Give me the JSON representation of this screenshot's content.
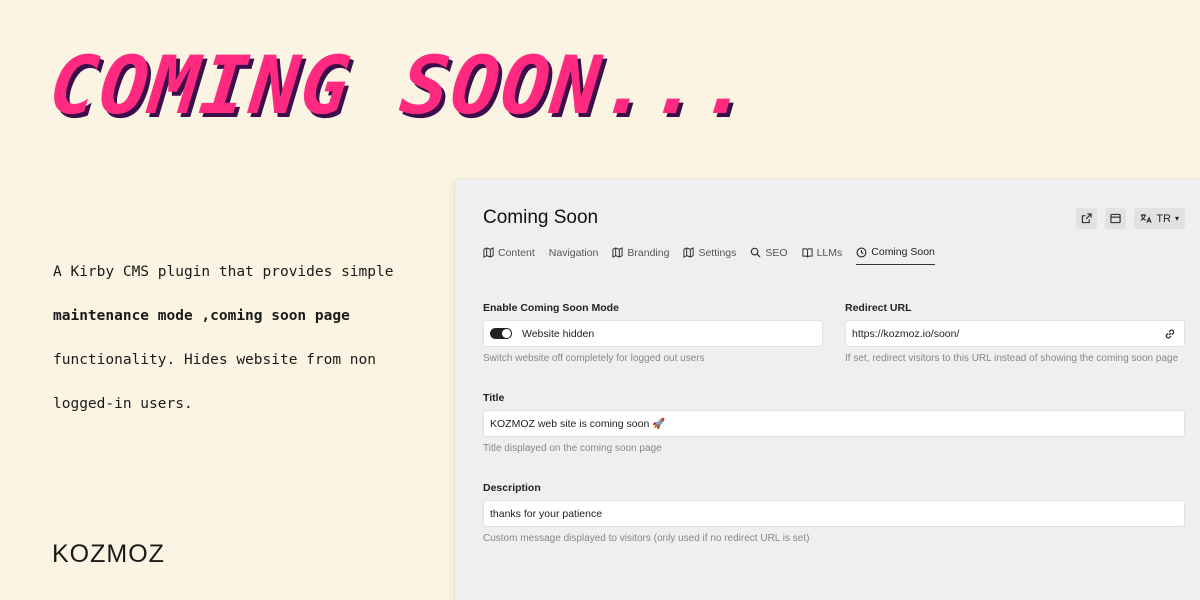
{
  "headline": "COMING SOON...",
  "description": {
    "line1": "A Kirby CMS plugin that provides simple",
    "line2": "maintenance mode ,coming soon page",
    "line3": "functionality. Hides website from non",
    "line4": "logged-in users."
  },
  "logo": "KOZMOZ",
  "panel": {
    "title": "Coming Soon",
    "toolbar": {
      "open_icon": "external-link-icon",
      "preview_icon": "window-icon",
      "language_icon": "translate-icon",
      "language": "TR"
    },
    "tabs": [
      {
        "label": "Content",
        "icon": "map-icon"
      },
      {
        "label": "Navigation",
        "icon": ""
      },
      {
        "label": "Branding",
        "icon": "map-icon"
      },
      {
        "label": "Settings",
        "icon": "map-icon"
      },
      {
        "label": "SEO",
        "icon": "search-icon"
      },
      {
        "label": "LLMs",
        "icon": "map-icon"
      },
      {
        "label": "Coming Soon",
        "icon": "clock-icon"
      }
    ],
    "fields": {
      "enable": {
        "label": "Enable Coming Soon Mode",
        "value": "Website hidden",
        "help": "Switch website off completely for logged out users"
      },
      "redirect": {
        "label": "Redirect URL",
        "value": "https://kozmoz.io/soon/",
        "help": "If set, redirect visitors to this URL instead of showing the coming soon page"
      },
      "title": {
        "label": "Title",
        "value": "KOZMOZ web site is coming soon 🚀",
        "help": "Title displayed on the coming soon page"
      },
      "description": {
        "label": "Description",
        "value": "thanks for your patience",
        "help": "Custom message displayed to visitors (only used if no redirect URL is set)"
      }
    }
  },
  "colors": {
    "background": "#fbf4e2",
    "headline": "#ff2a7f",
    "headline_shadow": "#3b0d4a",
    "panel": "#efefef"
  }
}
